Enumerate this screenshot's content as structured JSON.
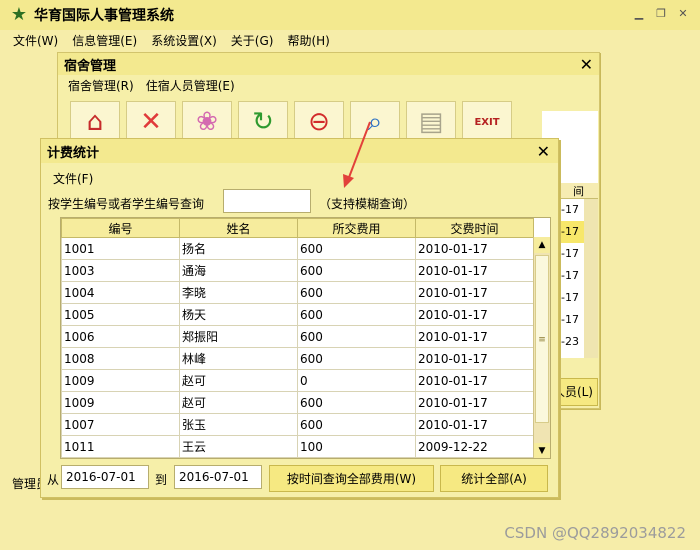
{
  "app": {
    "title": "华育国际人事管理系统",
    "menu": [
      "文件(W)",
      "信息管理(E)",
      "系统设置(X)",
      "关于(G)",
      "帮助(H)"
    ],
    "bottom_label": "管理员",
    "watermark": "CSDN @QQ2892034822"
  },
  "dorm_window": {
    "title": "宿舍管理",
    "menu": [
      "宿舍管理(R)",
      "住宿人员管理(E)"
    ],
    "toolbar_icons": [
      "home-icon",
      "delete-icon",
      "people-icon",
      "refresh-icon",
      "remove-icon",
      "search-icon",
      "document-icon",
      "exit-icon"
    ],
    "exit_label": "EXIT",
    "side_header": "间",
    "side_rows": [
      "-17",
      "-17",
      "-17",
      "-17",
      "-17",
      "-17",
      "-23"
    ],
    "staff_button": "人员(L)"
  },
  "fee_window": {
    "title": "计费统计",
    "menu_file": "文件(F)",
    "query_label": "按学生编号或者学生编号查询",
    "query_value": "",
    "query_hint": "（支持模糊查询）",
    "table": {
      "columns": [
        "编号",
        "姓名",
        "所交费用",
        "交费时间"
      ],
      "rows": [
        [
          "1001",
          "扬名",
          "600",
          "2010-01-17"
        ],
        [
          "1003",
          "通海",
          "600",
          "2010-01-17"
        ],
        [
          "1004",
          "李晓",
          "600",
          "2010-01-17"
        ],
        [
          "1005",
          "杨天",
          "600",
          "2010-01-17"
        ],
        [
          "1006",
          "郑振阳",
          "600",
          "2010-01-17"
        ],
        [
          "1008",
          "林峰",
          "600",
          "2010-01-17"
        ],
        [
          "1009",
          "赵可",
          "0",
          "2010-01-17"
        ],
        [
          "1009",
          "赵可",
          "600",
          "2010-01-17"
        ],
        [
          "1007",
          "张玉",
          "600",
          "2010-01-17"
        ],
        [
          "1011",
          "王云",
          "100",
          "2009-12-22"
        ]
      ]
    },
    "from_label": "从",
    "date_from": "2016-07-01",
    "to_label": "到",
    "date_to": "2016-07-01",
    "query_all_button": "按时间查询全部费用(W)",
    "stat_all_button": "统计全部(A)"
  }
}
